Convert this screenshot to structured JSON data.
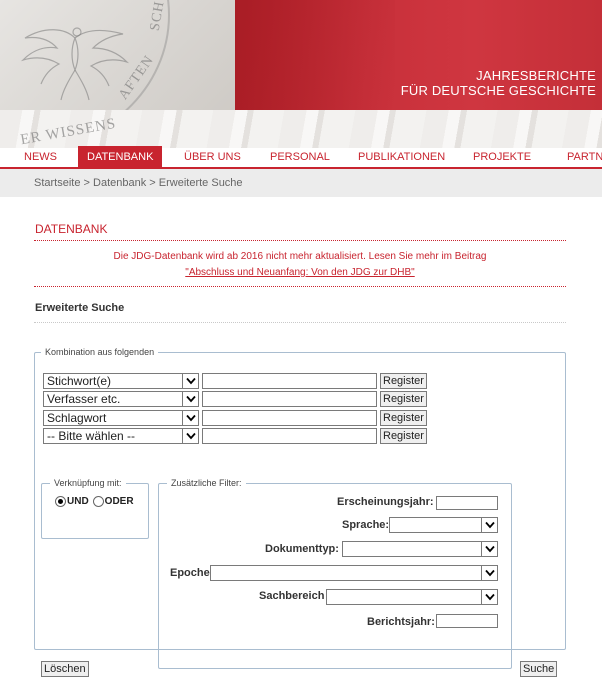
{
  "header": {
    "title_line1": "JAHRESBERICHTE",
    "title_line2": "FÜR DEUTSCHE GESCHICHTE",
    "seal_text_1": "ER WISSENS",
    "seal_text_2": "AFTEN",
    "seal_text_3": "SCH"
  },
  "nav": {
    "items": [
      {
        "label": "NEWS"
      },
      {
        "label": "DATENBANK",
        "active": true
      },
      {
        "label": "ÜBER UNS"
      },
      {
        "label": "PERSONAL"
      },
      {
        "label": "PUBLIKATIONEN"
      },
      {
        "label": "PROJEKTE"
      },
      {
        "label": "PARTNE"
      }
    ]
  },
  "breadcrumb": {
    "home": "Startseite",
    "sep1": " > ",
    "datenbank": "Datenbank",
    "sep2": " > ",
    "current": "Erweiterte Suche"
  },
  "section": {
    "title": "DATENBANK",
    "notice_line1": "Die JDG-Datenbank wird ab 2016 nicht mehr aktualisiert. Lesen Sie mehr im Beitrag",
    "notice_link": "\"Abschluss und Neuanfang: Von den JDG zur DHB\"",
    "subtitle": "Erweiterte Suche"
  },
  "search": {
    "legend": "Kombination aus folgenden",
    "rows": [
      {
        "field": "Stichwort(e)",
        "value": "",
        "button": "Register"
      },
      {
        "field": "Verfasser etc.",
        "value": "",
        "button": "Register"
      },
      {
        "field": "Schlagwort",
        "value": "",
        "button": "Register"
      },
      {
        "field": "-- Bitte wählen --",
        "value": "",
        "button": "Register"
      }
    ]
  },
  "combine": {
    "legend": "Verknüpfung mit:",
    "und": "UND",
    "oder": "ODER",
    "selected": "UND"
  },
  "filters": {
    "legend": "Zusätzliche Filter:",
    "erscheinungsjahr": "Erscheinungsjahr:",
    "sprache": "Sprache:",
    "dokumenttyp": "Dokumenttyp:",
    "epoche": "Epoche",
    "sachbereich": "Sachbereich",
    "berichtsjahr": "Berichtsjahr:"
  },
  "actions": {
    "clear": "Löschen",
    "search": "Suche"
  },
  "colors": {
    "brand_red": "#c8242f",
    "fieldset_border": "#a9bdd0"
  }
}
